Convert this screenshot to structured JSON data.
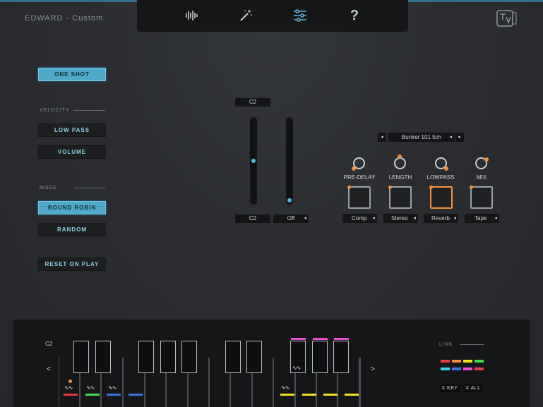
{
  "window": {
    "title": "EDWARD - Custom"
  },
  "toolbar": {
    "icons": [
      "waveform-icon",
      "magic-wand-icon",
      "sliders-icon",
      "help-icon"
    ],
    "help_glyph": "?"
  },
  "left_panel": {
    "one_shot": "ONE SHOT",
    "velocity_label": "VELOCITY",
    "low_pass": "LOW PASS",
    "volume": "VOLUME",
    "mode_label": "MODE",
    "round_robin": "ROUND ROBIN",
    "random": "RANDOM",
    "reset_on_play": "RESET ON PLAY"
  },
  "range": {
    "top_note": "C2",
    "bottom_note": "C2",
    "mode_value": "Off",
    "arrow": "◂"
  },
  "reverb": {
    "preset_prev": "◂",
    "preset_next": "▸",
    "preset": "Bunker 101 5ch",
    "preset_menu": "◂",
    "knobs": [
      "PRE-DELAY",
      "LENGTH",
      "LOWPASS",
      "MIX"
    ],
    "effects": [
      "Comp",
      "Stereo",
      "Reverb",
      "Tape"
    ],
    "effect_arrow": "◂"
  },
  "keyboard": {
    "note": "C2",
    "nav_left": "<",
    "nav_right": ">",
    "link_label": "LINK",
    "x_key": "X KEY",
    "x_all": "X ALL",
    "wave_glyph": "∿∿",
    "colors": {
      "accent": "#4fa8c8",
      "orange": "#f3913b",
      "pink": "#e94fd6",
      "yellow": "#f0e21b",
      "red": "#e53b3b",
      "green": "#3ddc4a",
      "blue": "#3a73e0",
      "cyan": "#35d6e6"
    }
  }
}
